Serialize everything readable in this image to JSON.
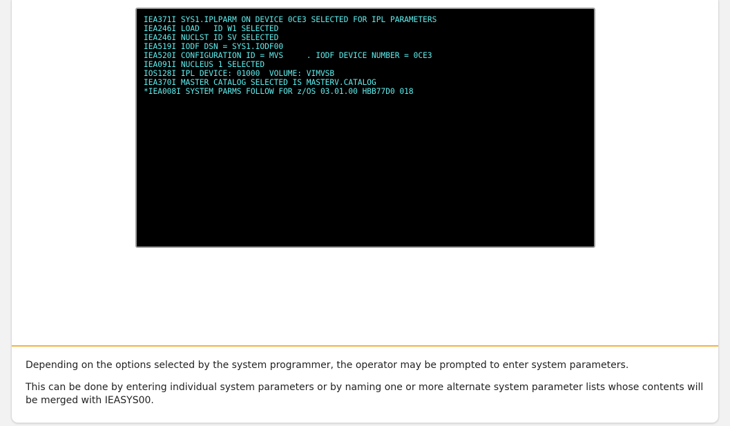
{
  "terminal": {
    "lines": [
      "IEA371I SYS1.IPLPARM ON DEVICE 0CE3 SELECTED FOR IPL PARAMETERS",
      "IEA246I LOAD   ID W1 SELECTED",
      "IEA246I NUCLST ID SV SELECTED",
      "IEA519I IODF DSN = SYS1.IODF00",
      "IEA520I CONFIGURATION ID = MVS     . IODF DEVICE NUMBER = 0CE3",
      "IEA091I NUCLEUS 1 SELECTED",
      "IOS128I IPL DEVICE: 01000  VOLUME: VIMVSB",
      "IEA370I MASTER CATALOG SELECTED IS MASTERV.CATALOG",
      "*IEA008I SYSTEM PARMS FOLLOW FOR z/OS 03.01.00 HBB77D0 018"
    ],
    "text_color": "#5ff0f0",
    "background_color": "#000000"
  },
  "notes": {
    "paragraph_1": "Depending on the options selected by the system programmer, the operator may be prompted to enter system parameters.",
    "paragraph_2": "This can be done by entering individual system parameters or by naming one or more alternate system parameter lists whose contents will be merged with IEASYS00."
  },
  "colors": {
    "divider": "#f3b23c",
    "card": "#ffffff",
    "page_background": "#f2f2f2"
  }
}
